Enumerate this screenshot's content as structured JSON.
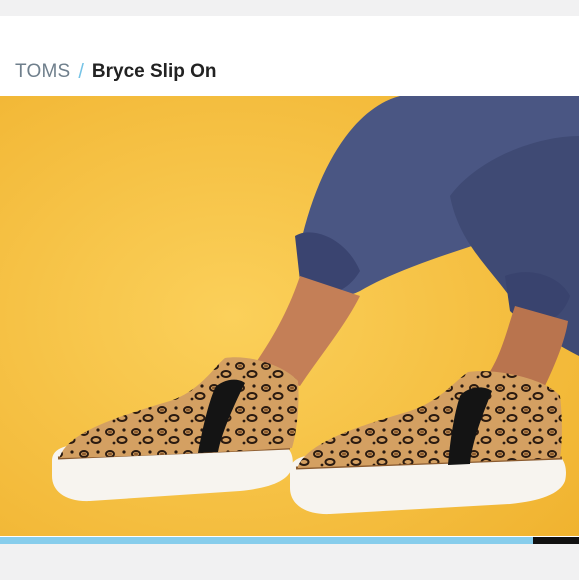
{
  "breadcrumb": {
    "brand": "TOMS",
    "separator": "/",
    "title": "Bryce Slip On"
  },
  "gallery": {
    "image_alt": "Leopard print slip-on sneakers",
    "progress_fraction": 0.92
  },
  "colors": {
    "background": "#f6be3c",
    "accent": "#87cdec",
    "brand_text": "#6f7f8c"
  }
}
